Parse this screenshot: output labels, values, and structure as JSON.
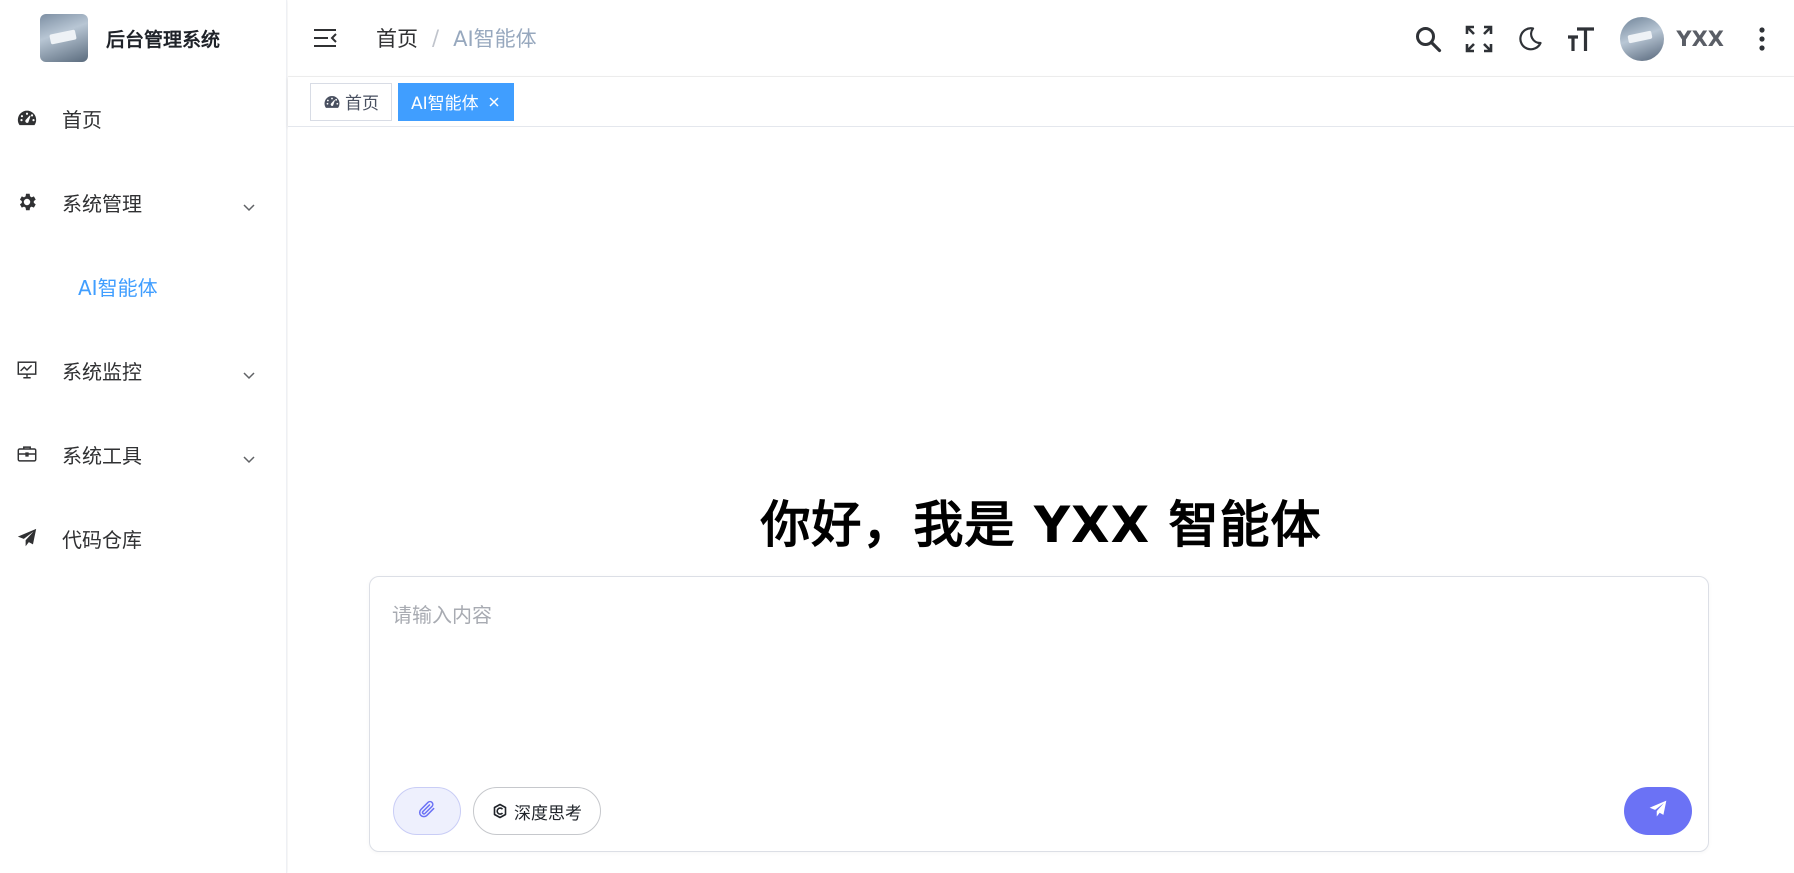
{
  "brand": {
    "title": "后台管理系统"
  },
  "sidebar": {
    "items": [
      {
        "label": "首页",
        "icon": "dashboard-icon"
      },
      {
        "label": "系统管理",
        "icon": "gear-icon",
        "expandable": true
      },
      {
        "label": "AI智能体",
        "active": true
      },
      {
        "label": "系统监控",
        "icon": "monitor-icon",
        "expandable": true
      },
      {
        "label": "系统工具",
        "icon": "toolbox-icon",
        "expandable": true
      },
      {
        "label": "代码仓库",
        "icon": "paper-plane-icon"
      }
    ]
  },
  "header": {
    "breadcrumb": {
      "home": "首页",
      "separator": "/",
      "current": "AI智能体"
    },
    "username": "YXX"
  },
  "tags": [
    {
      "label": "首页",
      "active": false
    },
    {
      "label": "AI智能体",
      "active": true
    }
  ],
  "main": {
    "greeting": "你好，我是 YXX 智能体",
    "input_placeholder": "请输入内容",
    "deep_think_label": "深度思考"
  },
  "colors": {
    "accent": "#409eff",
    "send": "#6b72f5",
    "attach_bg": "#eef0fd"
  }
}
